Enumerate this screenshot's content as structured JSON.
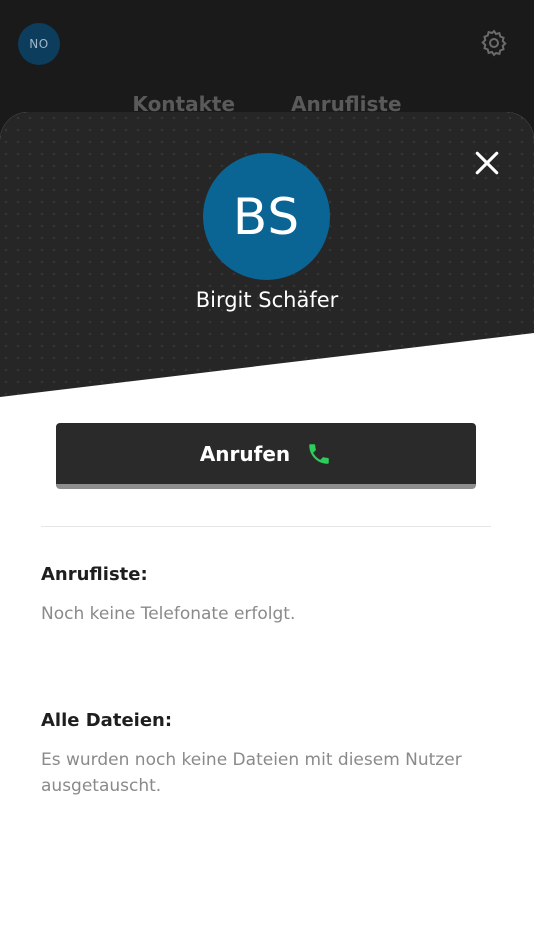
{
  "background": {
    "avatar_initials": "NO",
    "settings_icon": "gear-icon",
    "tabs": [
      {
        "label": "Kontakte"
      },
      {
        "label": "Anrufliste"
      }
    ]
  },
  "contact": {
    "initials": "BS",
    "name": "Birgit Schäfer",
    "avatar_color": "#0a6595"
  },
  "actions": {
    "close_icon": "close-icon",
    "call_label": "Anrufen",
    "call_icon": "phone-icon",
    "call_icon_color": "#2ecc5a"
  },
  "call_history": {
    "title": "Anrufliste:",
    "empty_text": "Noch keine Telefonate erfolgt."
  },
  "files": {
    "title": "Alle Dateien:",
    "empty_text": "Es wurden noch keine Dateien mit diesem Nutzer ausgetauscht."
  }
}
